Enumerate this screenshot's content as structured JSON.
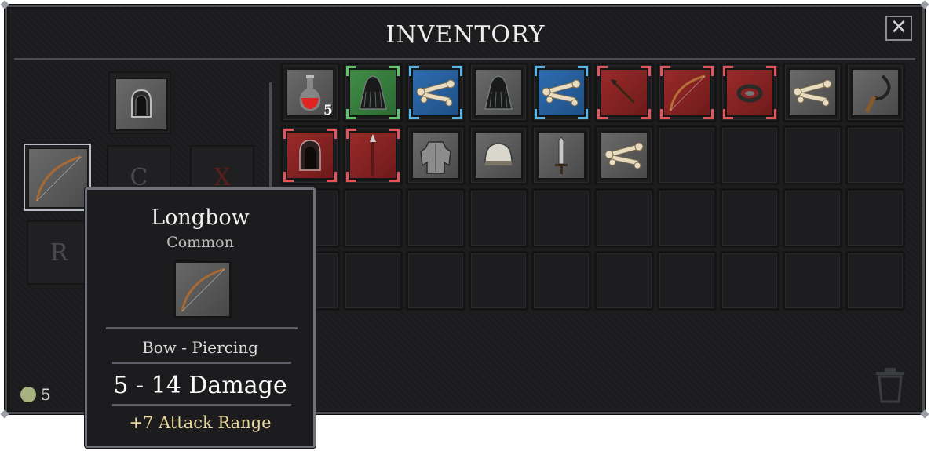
{
  "window": {
    "title": "INVENTORY",
    "close_label": "✕"
  },
  "equipment": {
    "slot_c_label": "C",
    "slot_x_label": "X",
    "slot_r_label": "R",
    "head_icon": "hood-icon",
    "weapon_icon": "longbow-icon"
  },
  "inventory": {
    "rows": 4,
    "cols": 10,
    "items": [
      {
        "icon": "red-potion-icon",
        "rarity": "common",
        "quantity": "5"
      },
      {
        "icon": "dark-cloak-icon",
        "rarity": "uncommon"
      },
      {
        "icon": "bones-icon",
        "rarity": "rare"
      },
      {
        "icon": "dark-cloak-icon",
        "rarity": "common"
      },
      {
        "icon": "bones-icon",
        "rarity": "rare"
      },
      {
        "icon": "spear-head-icon",
        "rarity": "epic"
      },
      {
        "icon": "longbow-icon",
        "rarity": "epic"
      },
      {
        "icon": "ring-icon",
        "rarity": "epic"
      },
      {
        "icon": "bones-icon",
        "rarity": "common"
      },
      {
        "icon": "sickle-icon",
        "rarity": "common"
      },
      {
        "icon": "hood-icon",
        "rarity": "epic"
      },
      {
        "icon": "spear-icon",
        "rarity": "epic"
      },
      {
        "icon": "plate-armor-icon",
        "rarity": "common"
      },
      {
        "icon": "helmet-icon",
        "rarity": "common"
      },
      {
        "icon": "sword-icon",
        "rarity": "common"
      },
      {
        "icon": "bones-icon",
        "rarity": "common"
      }
    ]
  },
  "currency": {
    "amount": "5",
    "coin_color": "#a8b180"
  },
  "tooltip": {
    "name": "Longbow",
    "rarity": "Common",
    "icon": "longbow-icon",
    "type_line": "Bow  -  Piercing",
    "damage": "5 - 14 Damage",
    "bonus": "+7 Attack Range"
  },
  "colors": {
    "uncommon": "#5fc66a",
    "rare": "#59b6ea",
    "epic": "#e5545a",
    "bonus_text": "#e9d69a"
  }
}
